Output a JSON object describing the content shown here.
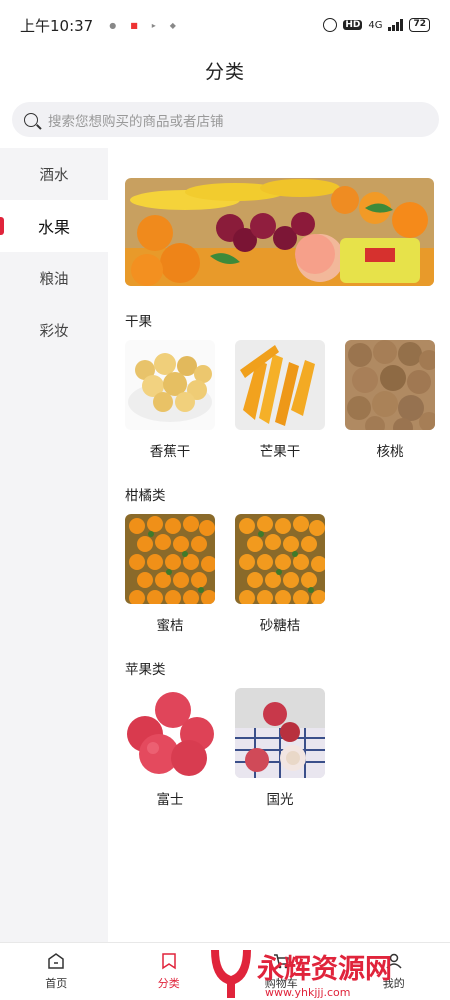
{
  "status": {
    "time": "上午10:37",
    "network": "4G",
    "battery": "72"
  },
  "header": {
    "title": "分类"
  },
  "search": {
    "placeholder": "搜索您想购买的商品或者店铺"
  },
  "sidebar": {
    "items": [
      {
        "label": "酒水",
        "active": false
      },
      {
        "label": "水果",
        "active": true
      },
      {
        "label": "粮油",
        "active": false
      },
      {
        "label": "彩妆",
        "active": false
      }
    ]
  },
  "sections": [
    {
      "title": "干果",
      "products": [
        {
          "name": "香蕉干",
          "icon": "banana-chips-image"
        },
        {
          "name": "芒果干",
          "icon": "dried-mango-image"
        },
        {
          "name": "核桃",
          "icon": "walnut-image"
        }
      ]
    },
    {
      "title": "柑橘类",
      "products": [
        {
          "name": "蜜桔",
          "icon": "tangerine-box-image"
        },
        {
          "name": "砂糖桔",
          "icon": "sugar-orange-image"
        }
      ]
    },
    {
      "title": "苹果类",
      "products": [
        {
          "name": "富士",
          "icon": "fuji-apple-image"
        },
        {
          "name": "国光",
          "icon": "guoguang-apple-image"
        }
      ]
    }
  ],
  "bottom_nav": [
    {
      "label": "首页",
      "icon": "home-icon",
      "active": false
    },
    {
      "label": "分类",
      "icon": "bookmark-icon",
      "active": true
    },
    {
      "label": "购物车",
      "icon": "cart-icon",
      "active": false
    },
    {
      "label": "我的",
      "icon": "user-icon",
      "active": false
    }
  ],
  "watermark": {
    "text": "永辉资源网",
    "url": "www.yhkjjj.com"
  },
  "colors": {
    "accent": "#e0243b",
    "sidebar_bg": "#f4f4f6",
    "search_bg": "#f1f1f4"
  }
}
